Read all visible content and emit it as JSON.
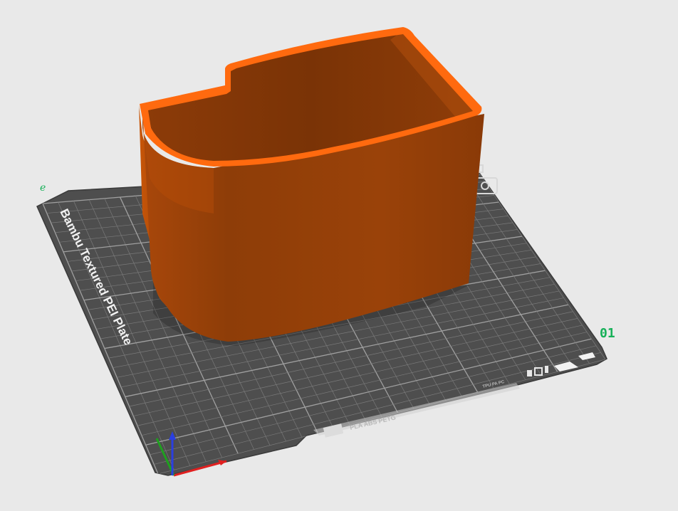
{
  "viewport": {
    "background": "#e9e9e9"
  },
  "build_plate": {
    "name": "Bambu Textured PEI Plate",
    "plate_number": "01",
    "corner_mark": "e",
    "front_label": "PLA ABS PETG",
    "front_sub_label": "TPU PA PC",
    "colors": {
      "surface": "#4e4e4e",
      "grid_line": "#7a7a7a",
      "grid_major": "#a0a0a0",
      "accent_green": "#16b058"
    }
  },
  "model": {
    "shape": "open-top bin with stepped back wall",
    "color_side": "#8a3a07",
    "color_side_light": "#b84c06",
    "color_rim": "#ff6a0f"
  },
  "axes": {
    "x_color": "#e02020",
    "y_color": "#1fa01f",
    "z_color": "#2a3fe0"
  }
}
